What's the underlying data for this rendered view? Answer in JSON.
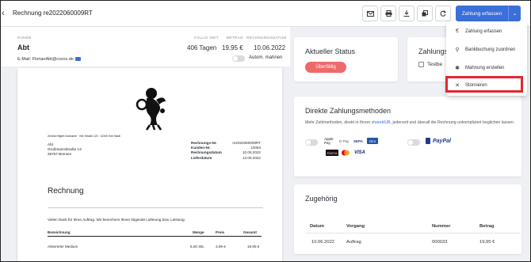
{
  "header": {
    "title": "Rechnung re2022060009RT",
    "actions": {
      "mail": "mail-icon",
      "print": "print-icon",
      "download": "download-icon",
      "copy": "copy-icon",
      "refresh": "refresh-icon"
    },
    "primary_button": "Zahlung erfassen"
  },
  "customer": {
    "label": "KUNDE",
    "name": "Abt",
    "email": "E-Mail: FlorianAbt@csvox.de",
    "due_label": "FÄLLIG SEIT",
    "due_value": "406 Tagen",
    "amount_label": "BETRAG",
    "amount_value": "19,95 €",
    "date_label": "RECHNUNGSDATUM",
    "date_value": "10.06.2022",
    "auto_reminder": "Autom. mahnen"
  },
  "document": {
    "sender_line": "Zentral Hilgert holcname · Ihre Straße 123 · 12345 Ihre Stadt",
    "address": [
      "Abt",
      "Großmannsbraße 13",
      "28757 Bremen"
    ],
    "meta": [
      {
        "k": "Rechnungs-Nr.",
        "v": "re2022060009RT"
      },
      {
        "k": "Kunden-Nr.",
        "v": "10093"
      },
      {
        "k": "Rechnungsdatum",
        "v": "10.06.2022"
      },
      {
        "k": "Lieferdatum",
        "v": "13.06.2022"
      }
    ],
    "heading": "Rechnung",
    "intro": "Vielen Dank für Ihren Auftrag. Wir berechnen Ihnen folgende Lieferung bzw. Leistung:",
    "columns": [
      "Bezeichnung",
      "Menge",
      "Preis",
      "Gesamt"
    ],
    "rows": [
      [
        "Alsterteler Medium",
        "5,00 Stk.",
        "3,99 €",
        "19,95 €"
      ]
    ]
  },
  "status_card": {
    "title": "Aktueller Status",
    "pill": "Überfällig"
  },
  "payment_card": {
    "title": "Zahlungs",
    "text": "Testbe"
  },
  "direct_payment": {
    "title": "Direkte Zahlungsmethoden",
    "text_before": "Mehr Zahlmethoden, direkt in Ihrem ",
    "link": "shareHUB",
    "text_after": ", jederzeit und überall die Rechnung unkompliziert beglichen lassen.",
    "methods": [
      "Apple Pay",
      "G Pay",
      "SEPA",
      "Giro",
      "Klarna",
      "Mastercard",
      "VISA",
      "PayPal"
    ]
  },
  "related": {
    "title": "Zugehörig",
    "columns": [
      "Datum",
      "Vorgang",
      "Nummer",
      "Betrag"
    ],
    "rows": [
      [
        "10.06.2022",
        "Auftrag",
        "000033",
        "19,95 €"
      ]
    ]
  },
  "menu": {
    "items": [
      "Zahlung erfassen",
      "Bankbuchung zuordnen",
      "Mahnung erstellen",
      "Stornieren"
    ],
    "icons": [
      "euro-icon",
      "link-icon",
      "gear-icon",
      "close-icon"
    ]
  },
  "colors": {
    "accent": "#3b6fd9",
    "danger": "#ee6a6a",
    "highlight": "#e0282e"
  }
}
